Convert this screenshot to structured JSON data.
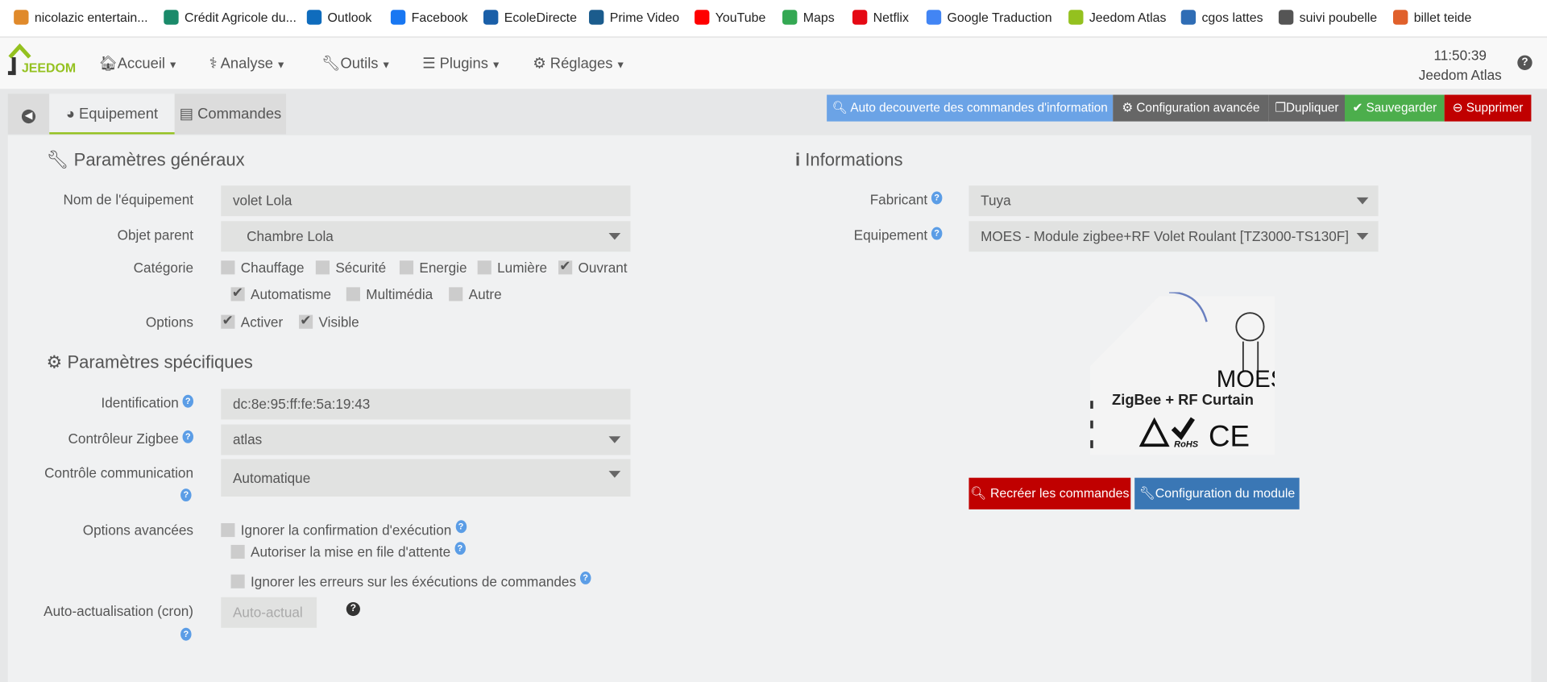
{
  "bookmarks": [
    {
      "label": "nicolazic entertain...",
      "icon": "user-icon",
      "color": "#e08a2b"
    },
    {
      "label": "Crédit Agricole du...",
      "icon": "credit-agricole-icon",
      "color": "#1a8a6a"
    },
    {
      "label": "Outlook",
      "icon": "outlook-icon",
      "color": "#0f6cbd"
    },
    {
      "label": "Facebook",
      "icon": "facebook-icon",
      "color": "#1877f2"
    },
    {
      "label": "EcoleDirecte",
      "icon": "ecoledirecte-icon",
      "color": "#1a5fa8"
    },
    {
      "label": "Prime Video",
      "icon": "prime-video-icon",
      "color": "#1b5c8d"
    },
    {
      "label": "YouTube",
      "icon": "youtube-icon",
      "color": "#ff0000"
    },
    {
      "label": "Maps",
      "icon": "maps-icon",
      "color": "#34a853"
    },
    {
      "label": "Netflix",
      "icon": "netflix-icon",
      "color": "#e50914"
    },
    {
      "label": "Google Traduction",
      "icon": "google-translate-icon",
      "color": "#4285f4"
    },
    {
      "label": "Jeedom Atlas",
      "icon": "jeedom-icon",
      "color": "#94c11f"
    },
    {
      "label": "cgos lattes",
      "icon": "cgos-icon",
      "color": "#2f6db5"
    },
    {
      "label": "suivi poubelle",
      "icon": "globe-icon",
      "color": "#555555"
    },
    {
      "label": "billet teide",
      "icon": "teide-icon",
      "color": "#e0602b"
    }
  ],
  "navbar": {
    "logo": "JEEDOM",
    "menus": [
      "Accueil",
      "Analyse",
      "Outils",
      "Plugins",
      "Réglages"
    ],
    "time": "11:50:39",
    "name": "Jeedom Atlas",
    "help": "?"
  },
  "tabs": {
    "equipement": "Equipement",
    "commandes": "Commandes"
  },
  "actions": {
    "auto": "Auto decouverte des commandes d'information",
    "config": "Configuration avancée",
    "dupliquer": "Dupliquer",
    "sauvegarder": "Sauvegarder",
    "supprimer": "Supprimer"
  },
  "general": {
    "title": "Paramètres généraux",
    "name_label": "Nom de l'équipement",
    "name_value": "volet Lola",
    "parent_label": "Objet parent",
    "parent_value": "Chambre Lola",
    "category_label": "Catégorie",
    "categories": [
      {
        "label": "Chauffage",
        "checked": false
      },
      {
        "label": "Sécurité",
        "checked": false
      },
      {
        "label": "Energie",
        "checked": false
      },
      {
        "label": "Lumière",
        "checked": false
      },
      {
        "label": "Ouvrant",
        "checked": true
      },
      {
        "label": "Automatisme",
        "checked": true
      },
      {
        "label": "Multimédia",
        "checked": false
      },
      {
        "label": "Autre",
        "checked": false
      }
    ],
    "options_label": "Options",
    "options": [
      {
        "label": "Activer",
        "checked": true
      },
      {
        "label": "Visible",
        "checked": true
      }
    ]
  },
  "specific": {
    "title": "Paramètres spécifiques",
    "id_label": "Identification",
    "id_value": "dc:8e:95:ff:fe:5a:19:43",
    "ctrl_label": "Contrôleur Zigbee",
    "ctrl_value": "atlas",
    "comm_label": "Contrôle communication",
    "comm_value": "Automatique",
    "adv_label": "Options avancées",
    "adv": [
      {
        "label": "Ignorer la confirmation d'exécution",
        "checked": false
      },
      {
        "label": "Autoriser la mise en file d'attente",
        "checked": false
      },
      {
        "label": "Ignorer les erreurs sur les éxécutions de commandes",
        "checked": false
      }
    ],
    "cron_label": "Auto-actualisation (cron)",
    "cron_placeholder": "Auto-actual"
  },
  "info": {
    "title": "Informations",
    "fab_label": "Fabricant",
    "fab_value": "Tuya",
    "equip_label": "Equipement",
    "equip_value": "MOES - Module zigbee+RF Volet Roulant [TZ3000-TS130F]",
    "image_text": {
      "brand": "MOES",
      "product": "ZigBee + RF Curtain",
      "mark": "RoHS"
    },
    "recreate": "Recréer les commandes",
    "module_config": "Configuration du module"
  },
  "colors": {
    "blue": "#6ba3e6",
    "gray": "#666666",
    "green": "#4cae4c",
    "red": "#c00000",
    "module": "#3a77b5",
    "accent": "#94c11f"
  }
}
